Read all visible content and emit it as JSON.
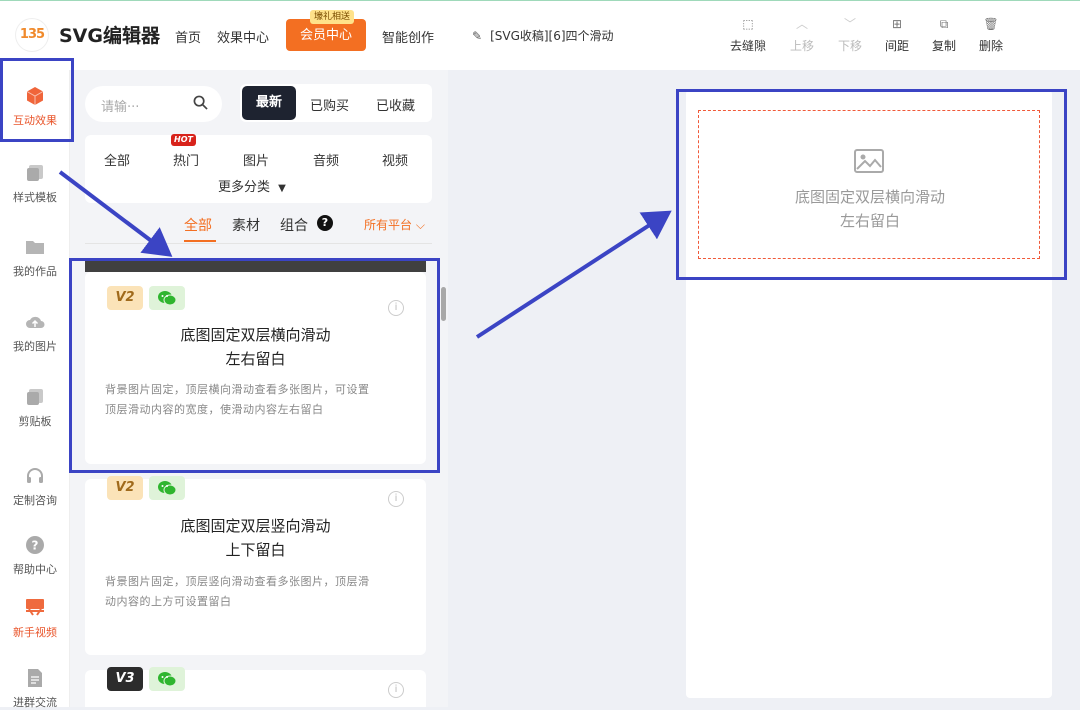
{
  "app": {
    "logo_mark": "135",
    "name": "SVG编辑器"
  },
  "nav": {
    "home": "首页",
    "effects": "效果中心",
    "vip": "会员中心",
    "vip_tag": "壕礼相送",
    "ai": "智能创作"
  },
  "document": {
    "title": "[SVG收稿][6]四个滑动"
  },
  "toolbar": {
    "remove_gap": "去缝隙",
    "move_up": "上移",
    "move_down": "下移",
    "spacing": "间距",
    "copy": "复制",
    "delete": "删除"
  },
  "sidebar": {
    "items": [
      {
        "label": "互动效果",
        "icon": "cube-icon"
      },
      {
        "label": "样式模板",
        "icon": "template-icon"
      },
      {
        "label": "我的作品",
        "icon": "folder-icon"
      },
      {
        "label": "我的图片",
        "icon": "cloud-upload-icon"
      },
      {
        "label": "剪贴板",
        "icon": "clipboard-icon"
      },
      {
        "label": "定制咨询",
        "icon": "headset-icon"
      },
      {
        "label": "帮助中心",
        "icon": "help-icon"
      },
      {
        "label": "新手视频",
        "icon": "video-stand-icon"
      },
      {
        "label": "进群交流",
        "icon": "document-icon"
      }
    ]
  },
  "panel": {
    "search_placeholder": "请输···",
    "tabs": {
      "latest": "最新",
      "purchased": "已购买",
      "favorited": "已收藏"
    },
    "categories": {
      "all": "全部",
      "hot": "热门",
      "hot_badge": "HOT",
      "image": "图片",
      "audio": "音频",
      "video": "视频",
      "more": "更多分类"
    },
    "filters": {
      "all": "全部",
      "material": "素材",
      "combo": "组合",
      "help": "?",
      "platform": "所有平台"
    },
    "cards": [
      {
        "version": "V2",
        "title_line1": "底图固定双层横向滑动",
        "title_line2": "左右留白",
        "desc_line1": "背景图片固定，顶层横向滑动查看多张图片，可设置",
        "desc_line2": "顶层滑动内容的宽度，使滑动内容左右留白"
      },
      {
        "version": "V2",
        "title_line1": "底图固定双层竖向滑动",
        "title_line2": "上下留白",
        "desc_line1": "背景图片固定，顶层竖向滑动查看多张图片，顶层滑",
        "desc_line2": "动内容的上方可设置留白"
      },
      {
        "version": "V3"
      }
    ]
  },
  "canvas": {
    "placeholder_line1": "底图固定双层横向滑动",
    "placeholder_line2": "左右留白"
  },
  "colors": {
    "accent": "#f36f22",
    "annotation": "#3b44c4",
    "dark": "#1e2330"
  }
}
